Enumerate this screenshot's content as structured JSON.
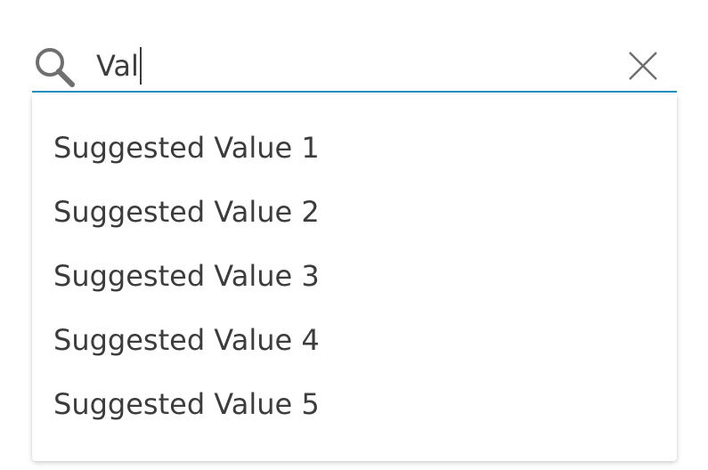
{
  "search": {
    "value": "Val",
    "icon": "search-icon",
    "clear_icon": "close-icon",
    "accent_color": "#1f8fbf"
  },
  "suggestions": [
    {
      "label": "Suggested Value 1"
    },
    {
      "label": "Suggested Value 2"
    },
    {
      "label": "Suggested Value 3"
    },
    {
      "label": "Suggested Value 4"
    },
    {
      "label": "Suggested Value 5"
    }
  ]
}
